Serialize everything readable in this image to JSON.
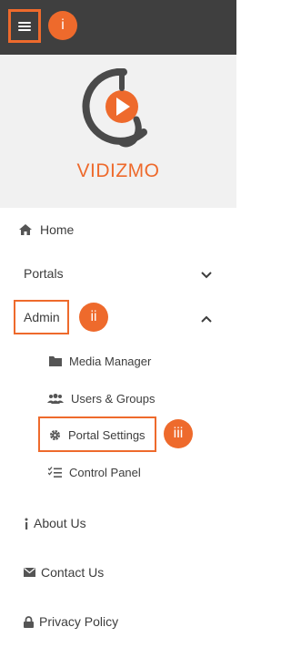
{
  "header": {
    "menu_icon": "hamburger-icon",
    "badge": "i"
  },
  "brand": {
    "name": "VIDIZMO",
    "accent": "#ee6a2c",
    "logo_icon": "play-logo-icon"
  },
  "nav": {
    "home": "Home",
    "portals": "Portals",
    "admin": "Admin",
    "admin_badge": "ii",
    "admin_items": {
      "media_manager": "Media Manager",
      "users_groups": "Users & Groups",
      "portal_settings": "Portal Settings",
      "portal_settings_badge": "iii",
      "control_panel": "Control Panel"
    },
    "about": "About Us",
    "contact": "Contact Us",
    "privacy": "Privacy Policy"
  }
}
